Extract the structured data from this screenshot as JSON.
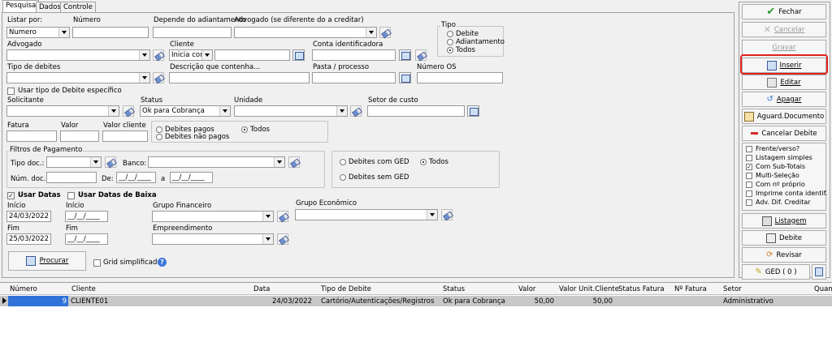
{
  "tabs": [
    "Pesquisa",
    "Dados",
    "Controle"
  ],
  "form": {
    "listar_por_label": "Listar por:",
    "listar_por_value": "Numero",
    "numero_label": "Número",
    "depende_label": "Depende do adiantamento",
    "advogado_creditar_label": "Advogado  (se diferente do a creditar)",
    "tipo_group_label": "Tipo",
    "tipo_options": [
      "Debite",
      "Adiantamento",
      "Todos"
    ],
    "advogado_label": "Advogado",
    "cliente_label": "Cliente",
    "cliente_mode": "Inicia com",
    "conta_label": "Conta identificadora",
    "tipo_debites_label": "Tipo de debites",
    "descricao_label": "Descrição que contenha...",
    "pasta_label": "Pasta / processo",
    "numero_os_label": "Número OS",
    "usar_tipo_label": "Usar tipo de Debite específico",
    "solicitante_label": "Solicitante",
    "status_label": "Status",
    "status_value": "Ok para Cobrança",
    "unidade_label": "Unidade",
    "setor_label": "Setor de custo",
    "fatura_label": "Fatura",
    "valor_label": "Valor",
    "valor_cliente_label": "Valor cliente",
    "pagos_options": [
      "Debites pagos",
      "Debites não pagos",
      "Todos"
    ],
    "filtros_label": "Filtros de Pagamento",
    "tipo_doc_label": "Tipo doc.:",
    "banco_label": "Banco:",
    "num_doc_label": "Núm. doc.:",
    "de_label": "De:",
    "a_label": "a",
    "date_mask": "__/__/____",
    "ged_options": [
      "Debites com GED",
      "Todos",
      "Debites sem GED"
    ],
    "usar_datas_label": "Usar Datas",
    "usar_datas_baixa_label": "Usar Datas de Baixa",
    "inicio_label": "Início",
    "inicio_value": "24/03/2022",
    "inicio2_label": "Início",
    "fim_label": "Fim",
    "fim_value": "25/03/2022",
    "fim2_label": "Fim",
    "grupo_fin_label": "Grupo Financeiro",
    "grupo_eco_label": "Grupo Econômico",
    "empreendimento_label": "Empreendimento",
    "procurar_label": "Procurar",
    "grid_simplificado_label": "Grid simplificado"
  },
  "actions": {
    "fechar": "Fechar",
    "cancelar": "Cancelar",
    "gravar": "Gravar",
    "inserir": "Inserir",
    "editar": "Editar",
    "apagar": "Apagar",
    "aguard_documento": "Aguard.Documento",
    "cancelar_debite": "Cancelar Debite",
    "listagem": "Listagem",
    "debite": "Debite",
    "revisar": "Revisar",
    "ged": "GED ( 0 )"
  },
  "options": [
    "Frente/verso?",
    "Listagem simples",
    "Com Sub-Totais",
    "Multi-Seleção",
    "Com nº próprio",
    "Imprime conta identif.",
    "Adv. Dif. Creditar"
  ],
  "options_checked": [
    false,
    false,
    true,
    false,
    false,
    false,
    false
  ],
  "grid": {
    "headers": [
      "Número",
      "Cliente",
      "Data",
      "Tipo de Debite",
      "Status",
      "Valor",
      "Valor Unit.Cliente",
      "Status Fatura",
      "Nº Fatura",
      "Setor",
      "Quan"
    ],
    "row": {
      "numero": "9",
      "cliente": "CLIENTE01",
      "data": "24/03/2022",
      "tipo": "Cartório/Autenticações/Registros",
      "status": "Ok para Cobrança",
      "valor": "50,00",
      "valor_unit": "50,00",
      "status_fatura": "",
      "n_fatura": "",
      "setor": "Administrativo"
    }
  },
  "colors": {
    "highlight": "#e02020",
    "selected_cell": "#3072d8",
    "row_bg": "#c8c8c8"
  }
}
